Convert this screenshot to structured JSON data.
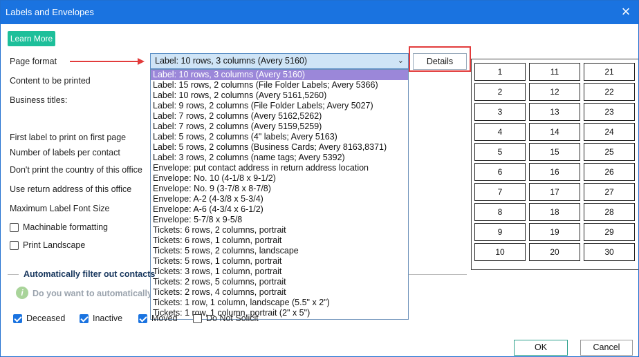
{
  "window": {
    "title": "Labels and Envelopes",
    "close_glyph": "×"
  },
  "learn_more": "Learn More",
  "labels": {
    "page_format": "Page format",
    "content": "Content to be printed",
    "business_titles": "Business titles:",
    "first_label": "First label to print on first page",
    "labels_per_contact": "Number of labels per contact",
    "dont_print_country": "Don't print the country of this office",
    "return_address": "Use return address of this office",
    "max_font": "Maximum Label Font Size"
  },
  "checkboxes": {
    "machinable": {
      "label": "Machinable formatting",
      "checked": false
    },
    "landscape": {
      "label": "Print Landscape",
      "checked": false
    }
  },
  "page_format_select": {
    "value": "Label: 10 rows, 3 columns (Avery 5160)",
    "chevron": "⌄",
    "options": [
      "Label: 10 rows, 3 columns (Avery 5160)",
      "Label: 15 rows, 2 columns (File Folder Labels; Avery 5366)",
      "Label: 10 rows, 2 columns (Avery 5161,5260)",
      "Label: 9 rows, 2 columns (File Folder Labels; Avery 5027)",
      "Label: 7 rows, 2 columns (Avery 5162,5262)",
      "Label: 7 rows, 2 columns (Avery 5159,5259)",
      "Label: 5 rows, 2 columns (4\" labels; Avery 5163)",
      "Label: 5 rows, 2 columns (Business Cards; Avery 8163,8371)",
      "Label: 3 rows, 2 columns (name tags; Avery 5392)",
      "Envelope: put contact address in return address location",
      "Envelope: No. 10 (4-1/8 x 9-1/2)",
      "Envelope: No. 9 (3-7/8 x 8-7/8)",
      "Envelope: A-2 (4-3/8 x 5-3/4)",
      "Envelope: A-6 (4-3/4 x 6-1/2)",
      "Envelope: 5-7/8 x 9-5/8",
      "Tickets: 6 rows, 2 columns, portrait",
      "Tickets: 6 rows, 1 column, portrait",
      "Tickets: 5 rows, 2 columns, landscape",
      "Tickets: 5 rows, 1 column, portrait",
      "Tickets: 3 rows, 1 column, portrait",
      "Tickets: 2 rows, 5 columns, portrait",
      "Tickets: 2 rows, 4 columns, portrait",
      "Tickets: 1 row, 1 column, landscape (5.5\" x 2\")",
      "Tickets: 1 row, 1 column, portrait (2\" x 5\")"
    ]
  },
  "details_button": "Details",
  "label_grid": [
    [
      "1",
      "11",
      "21"
    ],
    [
      "2",
      "12",
      "22"
    ],
    [
      "3",
      "13",
      "23"
    ],
    [
      "4",
      "14",
      "24"
    ],
    [
      "5",
      "15",
      "25"
    ],
    [
      "6",
      "16",
      "26"
    ],
    [
      "7",
      "17",
      "27"
    ],
    [
      "8",
      "18",
      "28"
    ],
    [
      "9",
      "19",
      "29"
    ],
    [
      "10",
      "20",
      "30"
    ]
  ],
  "filter_section": {
    "title": "Automatically filter out contacts",
    "info_icon": "i",
    "question": "Do you want to automatically f",
    "options": [
      {
        "label": "Deceased",
        "checked": true
      },
      {
        "label": "Inactive",
        "checked": true
      },
      {
        "label": "Moved",
        "checked": true
      },
      {
        "label": "Do Not Solicit",
        "checked": false
      }
    ]
  },
  "buttons": {
    "ok": "OK",
    "cancel": "Cancel"
  },
  "colors": {
    "title_bar": "#1a73e0",
    "accent_green": "#1dbf9a",
    "annotation_red": "#e23b3b",
    "selected_option": "#9b87d9"
  }
}
